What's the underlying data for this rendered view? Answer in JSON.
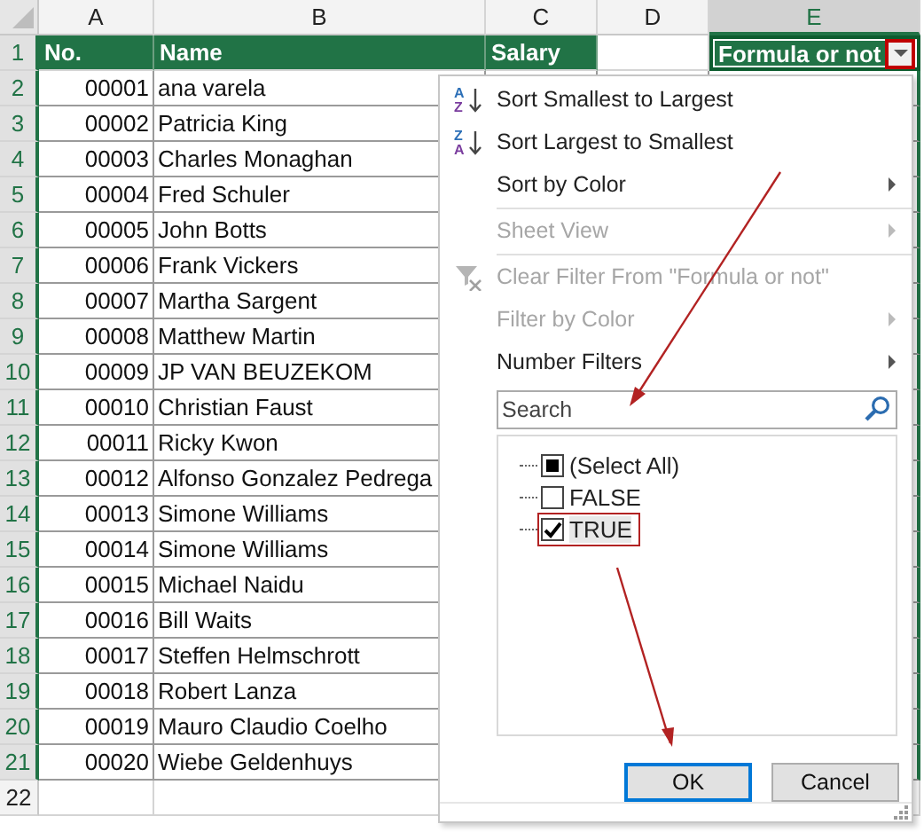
{
  "sheet": {
    "columns": [
      {
        "label": "A",
        "selected": false
      },
      {
        "label": "B",
        "selected": false
      },
      {
        "label": "C",
        "selected": false
      },
      {
        "label": "D",
        "selected": false
      },
      {
        "label": "E",
        "selected": true
      }
    ],
    "header_row": {
      "number": "1",
      "highlighted": true,
      "cells": [
        {
          "text": "No.",
          "filled": true
        },
        {
          "text": "Name",
          "filled": true
        },
        {
          "text": "Salary",
          "filled": true
        },
        {
          "filled": false
        },
        {
          "text": "Formula or not",
          "filled": true,
          "filter_button": {
            "outlined": true
          }
        }
      ]
    },
    "rows": [
      {
        "number": "2",
        "highlighted": true,
        "no": "00001",
        "name": "ana varela"
      },
      {
        "number": "3",
        "highlighted": true,
        "no": "00002",
        "name": "Patricia King"
      },
      {
        "number": "4",
        "highlighted": true,
        "no": "00003",
        "name": "Charles Monaghan"
      },
      {
        "number": "5",
        "highlighted": true,
        "no": "00004",
        "name": "Fred Schuler"
      },
      {
        "number": "6",
        "highlighted": true,
        "no": "00005",
        "name": "John Botts"
      },
      {
        "number": "7",
        "highlighted": true,
        "no": "00006",
        "name": "Frank Vickers"
      },
      {
        "number": "8",
        "highlighted": true,
        "no": "00007",
        "name": "Martha Sargent"
      },
      {
        "number": "9",
        "highlighted": true,
        "no": "00008",
        "name": "Matthew Martin"
      },
      {
        "number": "10",
        "highlighted": true,
        "no": "00009",
        "name": "JP VAN BEUZEKOM"
      },
      {
        "number": "11",
        "highlighted": true,
        "no": "00010",
        "name": "Christian Faust"
      },
      {
        "number": "12",
        "highlighted": true,
        "no": "00011",
        "name": "Ricky Kwon"
      },
      {
        "number": "13",
        "highlighted": true,
        "no": "00012",
        "name": "Alfonso Gonzalez Pedrega"
      },
      {
        "number": "14",
        "highlighted": true,
        "no": "00013",
        "name": "Simone Williams"
      },
      {
        "number": "15",
        "highlighted": true,
        "no": "00014",
        "name": "Simone Williams"
      },
      {
        "number": "16",
        "highlighted": true,
        "no": "00015",
        "name": "Michael Naidu"
      },
      {
        "number": "17",
        "highlighted": true,
        "no": "00016",
        "name": "Bill Waits"
      },
      {
        "number": "18",
        "highlighted": true,
        "no": "00017",
        "name": "Steffen Helmschrott"
      },
      {
        "number": "19",
        "highlighted": true,
        "no": "00018",
        "name": "Robert Lanza"
      },
      {
        "number": "20",
        "highlighted": true,
        "no": "00019",
        "name": "Mauro Claudio Coelho"
      },
      {
        "number": "21",
        "highlighted": true,
        "no": "00020",
        "name": "Wiebe Geldenhuys"
      },
      {
        "number": "22",
        "highlighted": false
      }
    ]
  },
  "filter_menu": {
    "items": [
      {
        "kind": "sort",
        "label": "Sort Smallest to Largest",
        "icon_letters": [
          "A",
          "Z"
        ],
        "disabled": false,
        "submenu": false
      },
      {
        "kind": "sort",
        "label": "Sort Largest to Smallest",
        "icon_letters": [
          "Z",
          "A"
        ],
        "disabled": false,
        "submenu": false
      },
      {
        "kind": "item",
        "label": "Sort by Color",
        "disabled": false,
        "submenu": true
      },
      {
        "kind": "separator"
      },
      {
        "kind": "item",
        "label": "Sheet View",
        "disabled": true,
        "submenu": true
      },
      {
        "kind": "separator"
      },
      {
        "kind": "clear",
        "label": "Clear Filter From \"Formula or not\"",
        "disabled": true,
        "submenu": false
      },
      {
        "kind": "item",
        "label": "Filter by Color",
        "disabled": true,
        "submenu": true
      },
      {
        "kind": "item",
        "label": "Number Filters",
        "disabled": false,
        "submenu": true
      }
    ],
    "search": {
      "placeholder": "Search"
    },
    "values": [
      {
        "label": "(Select All)",
        "checked": true,
        "indeterminate": true,
        "selected": false,
        "outlined": false
      },
      {
        "label": "FALSE",
        "checked": false,
        "selected": false,
        "outlined": false
      },
      {
        "label": "TRUE",
        "checked": true,
        "selected": true,
        "outlined": true
      }
    ],
    "buttons": [
      {
        "label": "OK",
        "default": true
      },
      {
        "label": "Cancel",
        "default": false
      }
    ]
  }
}
